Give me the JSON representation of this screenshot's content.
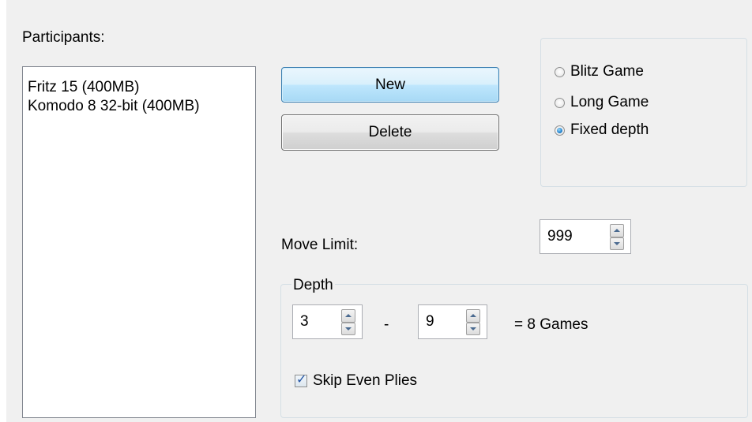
{
  "participants": {
    "label": "Participants:",
    "items": [
      "Fritz 15 (400MB)",
      "Komodo 8 32-bit (400MB)"
    ]
  },
  "buttons": {
    "new_label": "New",
    "delete_label": "Delete"
  },
  "game_mode": {
    "options": [
      {
        "label": "Blitz Game",
        "checked": false
      },
      {
        "label": "Long Game",
        "checked": false
      },
      {
        "label": "Fixed depth",
        "checked": true
      }
    ]
  },
  "move_limit": {
    "label": "Move Limit:",
    "value": "999"
  },
  "depth": {
    "title": "Depth",
    "from": "3",
    "separator": "-",
    "to": "9",
    "games_text": "= 8 Games",
    "skip_even_plies_label": "Skip Even Plies",
    "skip_even_plies_checked": true
  },
  "colors": {
    "accent": "#3c7fb1",
    "radio_dot": "#2a8ad4",
    "check": "#2455a4"
  }
}
